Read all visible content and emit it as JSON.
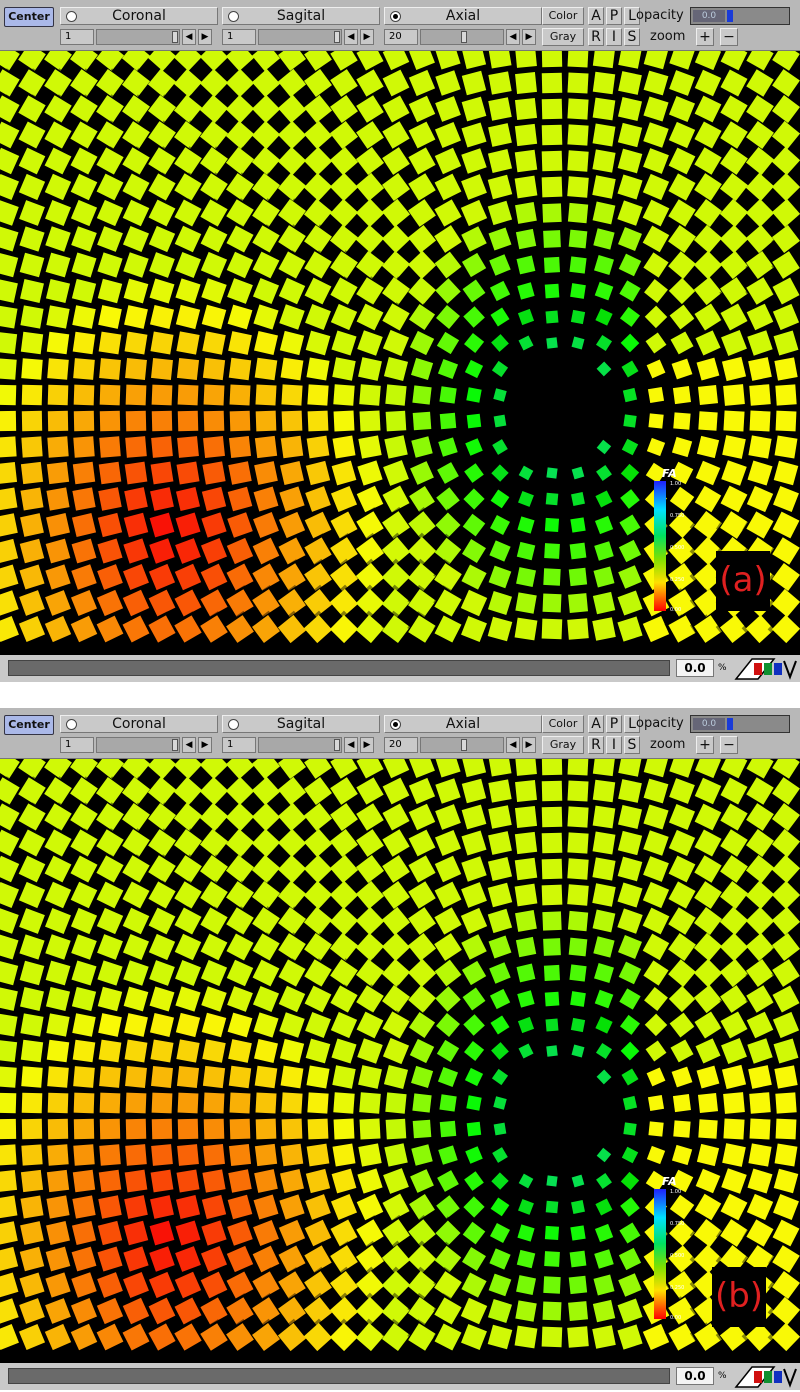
{
  "panels": [
    {
      "toolbar": {
        "center_label": "Center",
        "views": [
          {
            "label": "Coronal",
            "selected": false,
            "slice": "1"
          },
          {
            "label": "Sagital",
            "selected": false,
            "slice": "1"
          },
          {
            "label": "Axial",
            "selected": true,
            "slice": "20"
          }
        ],
        "color_label": "Color",
        "gray_label": "Gray",
        "orient_top": [
          "A",
          "P",
          "L"
        ],
        "orient_bottom": [
          "R",
          "I",
          "S"
        ],
        "opacity_label": "opacity",
        "opacity_value": "0.0",
        "zoom_label": "zoom",
        "zoom_in": "+",
        "zoom_out": "−"
      },
      "legend": {
        "title": "FA",
        "ticks": [
          "1.00",
          "0.750",
          "0.500",
          "0.250",
          "0.00"
        ]
      },
      "panel_label": "(a)",
      "status": {
        "progress": "0.0",
        "percent_symbol": "%"
      }
    },
    {
      "toolbar": {
        "center_label": "Center",
        "views": [
          {
            "label": "Coronal",
            "selected": false,
            "slice": "1"
          },
          {
            "label": "Sagital",
            "selected": false,
            "slice": "1"
          },
          {
            "label": "Axial",
            "selected": true,
            "slice": "20"
          }
        ],
        "color_label": "Color",
        "gray_label": "Gray",
        "orient_top": [
          "A",
          "P",
          "L"
        ],
        "orient_bottom": [
          "R",
          "I",
          "S"
        ],
        "opacity_label": "opacity",
        "opacity_value": "0.0",
        "zoom_label": "zoom",
        "zoom_in": "+",
        "zoom_out": "−"
      },
      "legend": {
        "title": "FA",
        "ticks": [
          "1.00",
          "0.750",
          "0.500",
          "0.250",
          "0.00"
        ]
      },
      "panel_label": "(b)",
      "status": {
        "progress": "0.0",
        "percent_symbol": "%"
      }
    }
  ],
  "colors": {
    "toolbar_bg": "#b8b8b8",
    "center_button": "#aab8e8",
    "opacity_thumb": "#1a3bd8",
    "panel_label": "#e02020"
  }
}
